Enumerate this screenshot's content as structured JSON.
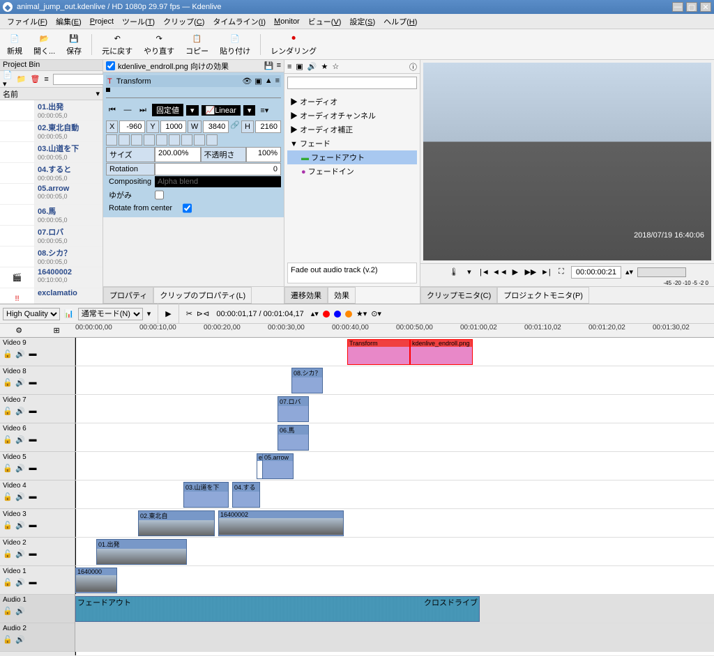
{
  "titlebar": {
    "text": "animal_jump_out.kdenlive / HD 1080p 29.97 fps — Kdenlive"
  },
  "menubar": [
    {
      "label": "ファイル",
      "accel": "F"
    },
    {
      "label": "編集",
      "accel": "E"
    },
    {
      "label": "Project",
      "accel": "r"
    },
    {
      "label": "ツール",
      "accel": "T"
    },
    {
      "label": "クリップ",
      "accel": "C"
    },
    {
      "label": "タイムライン",
      "accel": "I"
    },
    {
      "label": "Monitor",
      "accel": ""
    },
    {
      "label": "ビュー",
      "accel": "V"
    },
    {
      "label": "設定",
      "accel": "S"
    },
    {
      "label": "ヘルプ",
      "accel": "H"
    }
  ],
  "toolbar": [
    {
      "icon": "📄",
      "label": "新規"
    },
    {
      "icon": "📂",
      "label": "開く..."
    },
    {
      "icon": "💾",
      "label": "保存"
    },
    {
      "icon": "↶",
      "label": "元に戻す"
    },
    {
      "icon": "↷",
      "label": "やり直す"
    },
    {
      "icon": "📋",
      "label": "コピー"
    },
    {
      "icon": "📄",
      "label": "貼り付け"
    },
    {
      "icon": "⏺",
      "label": "レンダリング"
    }
  ],
  "bin": {
    "title": "Project Bin",
    "column": "名前",
    "items": [
      {
        "name": "01.出発",
        "dur": "00:00:05,0"
      },
      {
        "name": "02.東北自動",
        "dur": "00:00:05,0"
      },
      {
        "name": "03.山道を下",
        "dur": "00:00:05,0"
      },
      {
        "name": "04.すると",
        "dur": "00:00:05,0"
      },
      {
        "name": "05.arrow",
        "dur": "00:00:05,0"
      },
      {
        "name": "06.馬",
        "dur": "00:00:05,0"
      },
      {
        "name": "07.ロバ",
        "dur": "00:00:05,0"
      },
      {
        "name": "08.シカ？",
        "dur": "00:00:05,0"
      },
      {
        "name": "16400002",
        "dur": "00:10:00,0"
      },
      {
        "name": "exclamatio",
        "dur": ""
      }
    ]
  },
  "effect": {
    "target": "kdenlive_endroll.png 向けの効果",
    "name": "Transform",
    "x": "-960",
    "y": "1000",
    "w": "3840",
    "h": "2160",
    "size_lbl": "サイズ",
    "size_val": "200.00%",
    "opacity_lbl": "不透明さ",
    "opacity_val": "100%",
    "rotation_lbl": "Rotation",
    "rotation_val": "0",
    "compositing_lbl": "Compositing",
    "compositing_val": "Alpha blend",
    "distort_lbl": "ゆがみ",
    "rfc_lbl": "Rotate from center",
    "kf_mode": "固定値",
    "kf_interp": "Linear",
    "tabs": {
      "property": "プロパティ",
      "clip_property": "クリップのプロパティ(L)"
    }
  },
  "midpanel": {
    "tree": [
      {
        "label": "オーディオ",
        "expand": "▶"
      },
      {
        "label": "オーディオチャンネル",
        "expand": "▶"
      },
      {
        "label": "オーディオ補正",
        "expand": "▶"
      },
      {
        "label": "フェード",
        "expand": "▼",
        "children": [
          {
            "label": "フェードアウト",
            "sel": true,
            "icon": "green"
          },
          {
            "label": "フェードイン",
            "sel": false,
            "icon": "purple"
          }
        ]
      }
    ],
    "desc": "Fade out audio track (v.2)",
    "tabs": {
      "transition": "遷移効果",
      "effect": "効果"
    }
  },
  "monitor": {
    "timecode": "00:00:00:21",
    "tabs": {
      "clip": "クリップモニタ(C)",
      "project": "プロジェクトモニタ(P)"
    },
    "meter_labels": "-45  -20  -10  -5  -2  0"
  },
  "timeline": {
    "quality": "High Quality",
    "mode": "通常モード(N)",
    "tc1": "00:00:01,17",
    "tc2": "00:01:04,17",
    "ruler": [
      "00:00:00,00",
      "00:00:10,00",
      "00:00:20,00",
      "00:00:30,00",
      "00:00:40,00",
      "00:00:50,00",
      "00:01:00,02",
      "00:01:10,02",
      "00:01:20,02",
      "00:01:30,02"
    ],
    "tracks": [
      {
        "name": "Video 9"
      },
      {
        "name": "Video 8"
      },
      {
        "name": "Video 7"
      },
      {
        "name": "Video 6"
      },
      {
        "name": "Video 5"
      },
      {
        "name": "Video 4"
      },
      {
        "name": "Video 3"
      },
      {
        "name": "Video 2"
      },
      {
        "name": "Video 1"
      },
      {
        "name": "Audio 1",
        "audio": true
      },
      {
        "name": "Audio 2",
        "audio": true
      }
    ],
    "clips": {
      "v9a": "Transform",
      "v9b": "kdenlive_endroll.png",
      "v8": "08.シカ？",
      "v7": "07.ロバ",
      "v6": "06.馬",
      "v5": "exclamat",
      "v5b": "05.arrow",
      "v4a": "03.山道を下",
      "v4b": "04.する",
      "v3a": "02.東北自",
      "v3b": "16400002",
      "v2": "01.出発",
      "v1": "1640000",
      "a1a": "フェードアウト",
      "a1b": "クロスドライブ"
    }
  }
}
